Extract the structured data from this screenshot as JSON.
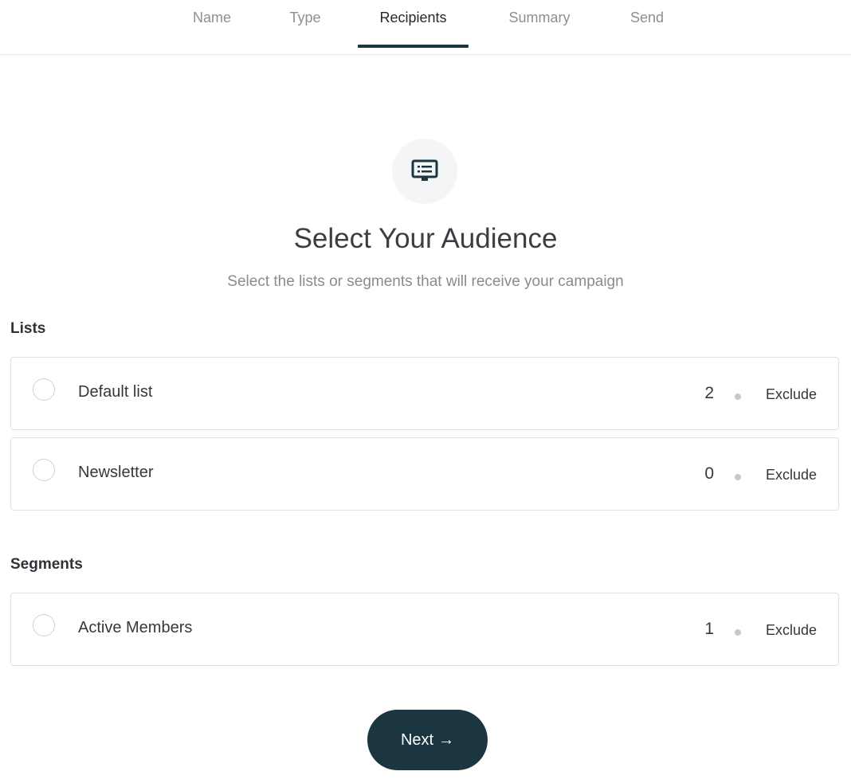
{
  "tabs": [
    {
      "label": "Name",
      "active": false
    },
    {
      "label": "Type",
      "active": false
    },
    {
      "label": "Recipients",
      "active": true
    },
    {
      "label": "Summary",
      "active": false
    },
    {
      "label": "Send",
      "active": false
    }
  ],
  "header": {
    "icon": "list-icon",
    "title": "Select Your Audience",
    "subtitle": "Select the lists or segments that will receive your campaign"
  },
  "lists": {
    "heading": "Lists",
    "items": [
      {
        "label": "Default list",
        "count": "2",
        "exclude_label": "Exclude",
        "selected": false
      },
      {
        "label": "Newsletter",
        "count": "0",
        "exclude_label": "Exclude",
        "selected": false
      }
    ]
  },
  "segments": {
    "heading": "Segments",
    "items": [
      {
        "label": "Active Members",
        "count": "1",
        "exclude_label": "Exclude",
        "selected": false
      }
    ]
  },
  "footer": {
    "next_label": "Next",
    "next_icon": "arrow-right-icon"
  },
  "colors": {
    "primary": "#1b3640",
    "border": "#dfe2e5",
    "muted_text": "#878c91"
  }
}
